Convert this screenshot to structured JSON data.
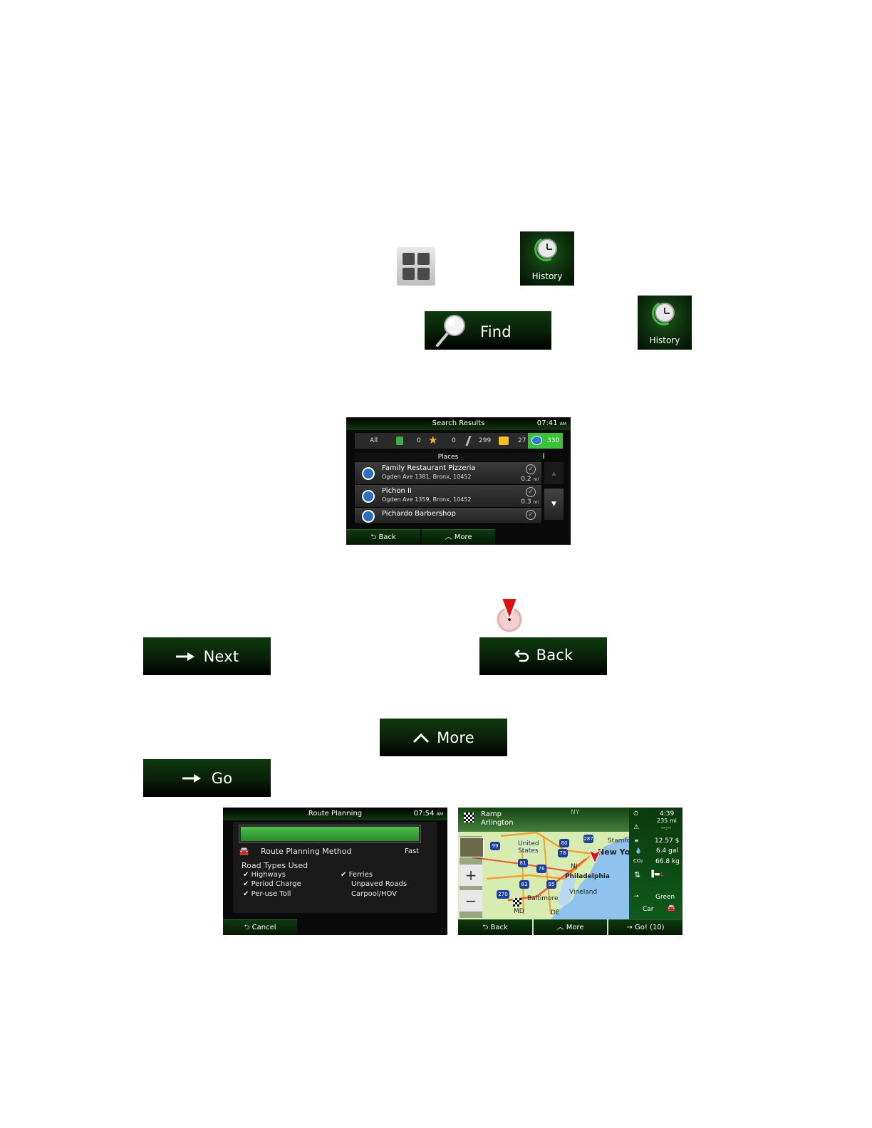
{
  "buttons": {
    "history_1": "History",
    "find": "Find",
    "history_2": "History",
    "next": "Next",
    "back": "Back",
    "more": "More",
    "go": "Go"
  },
  "search_results": {
    "title": "Search Results",
    "time": "07:41",
    "time_suffix": "AM",
    "tabs": [
      {
        "label": "All"
      },
      {
        "label": "0"
      },
      {
        "label": "0"
      },
      {
        "label": "299"
      },
      {
        "label": "27"
      },
      {
        "label": "330"
      }
    ],
    "section": "Places",
    "items": [
      {
        "name": "Family Restaurant Pizzeria",
        "address": "Ogden Ave 1381, Bronx, 10452",
        "distance": "0.2",
        "unit": "mi"
      },
      {
        "name": "Pichon II",
        "address": "Ogden Ave 1359, Bronx, 10452",
        "distance": "0.3",
        "unit": "mi"
      },
      {
        "name": "Pichardo Barbershop",
        "address": "",
        "distance": "",
        "unit": ""
      }
    ],
    "back_label": "Back",
    "more_label": "More"
  },
  "route_planning": {
    "title": "Route Planning",
    "time": "07:54",
    "time_suffix": "AM",
    "progress": 1.0,
    "method_label": "Route Planning Method",
    "method_value": "Fast",
    "road_types_label": "Road Types Used",
    "left_options": [
      {
        "label": "Highways",
        "checked": true
      },
      {
        "label": "Period Charge",
        "checked": true
      },
      {
        "label": "Per-use Toll",
        "checked": true
      }
    ],
    "right_options": [
      {
        "label": "Ferries",
        "checked": true
      },
      {
        "label": "Unpaved Roads",
        "checked": false
      },
      {
        "label": "Carpool/HOV",
        "checked": false
      }
    ],
    "cancel_label": "Cancel"
  },
  "map": {
    "header_line1": "Ramp",
    "header_line2": "Arlington",
    "labels": {
      "united_states": "United States",
      "new_york": "New Yor",
      "stamford": "Stamfo",
      "nj": "NJ",
      "philadelphia": "Philadelphia",
      "vineland": "Vineland",
      "baltimore": "Baltimore",
      "md": "MD",
      "de": "DE",
      "ny": "NY"
    },
    "shields": [
      "99",
      "80",
      "287",
      "78",
      "81",
      "76",
      "83",
      "95",
      "270"
    ],
    "panel": {
      "time": "4:39",
      "distance": "235 mi",
      "eta": "--:--",
      "cost": "12.57 $",
      "fuel": "6.4 gal",
      "co2": "66.8 kg",
      "mode": "Green",
      "vehicle": "Car"
    },
    "back_label": "Back",
    "more_label": "More",
    "go_label": "Go! (10)"
  },
  "colors": {
    "button_green": "#0d3a0d",
    "progress_green": "#3aa63a",
    "highlight_green": "#39c239",
    "map_sea": "#8fc3ee",
    "map_land": "#cfe8a8"
  }
}
